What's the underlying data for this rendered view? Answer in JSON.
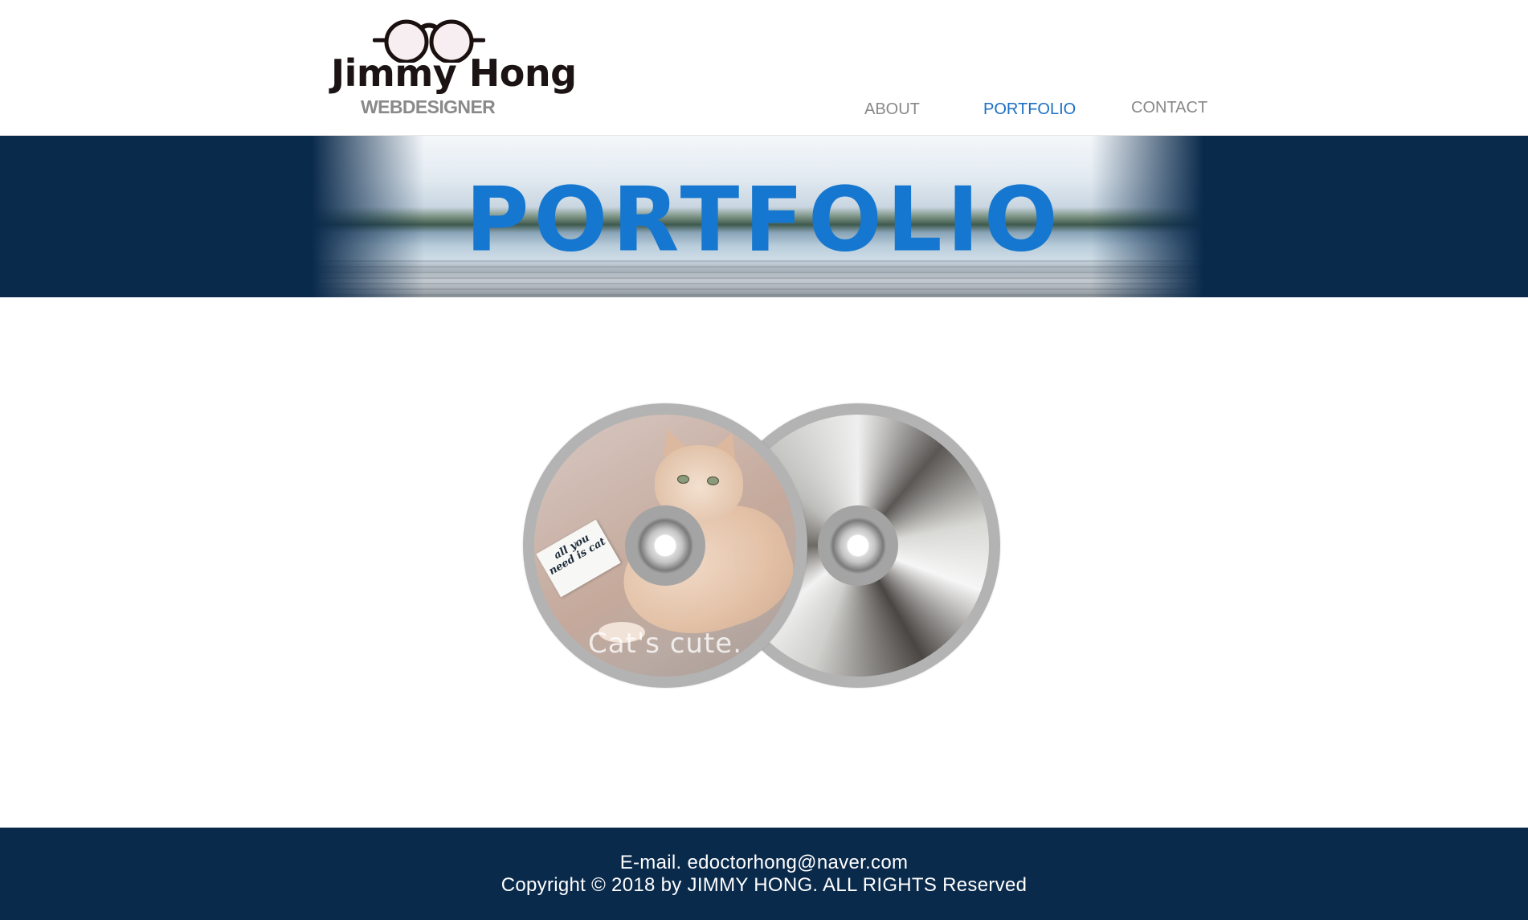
{
  "header": {
    "logo": {
      "name": "Jimmy Hong",
      "subtitle": "WEBDESIGNER",
      "icon": "glasses-icon"
    },
    "nav": [
      {
        "label": "ABOUT",
        "active": false
      },
      {
        "label": "PORTFOLIO",
        "active": true
      },
      {
        "label": "CONTACT",
        "active": false
      }
    ]
  },
  "banner": {
    "title": "PORTFOLIO"
  },
  "portfolio": {
    "items": [
      {
        "caption": "Cat's cute.",
        "note_text": "all you need is cat"
      },
      {
        "caption": ""
      }
    ]
  },
  "footer": {
    "email": "E-mail. edoctorhong@naver.com",
    "copyright": "Copyright © 2018 by JIMMY HONG. ALL RIGHTS Reserved"
  },
  "colors": {
    "navy": "#0a2a4c",
    "accent_blue": "#1577cf",
    "nav_active": "#1a6fc4",
    "nav_inactive": "#888888"
  }
}
